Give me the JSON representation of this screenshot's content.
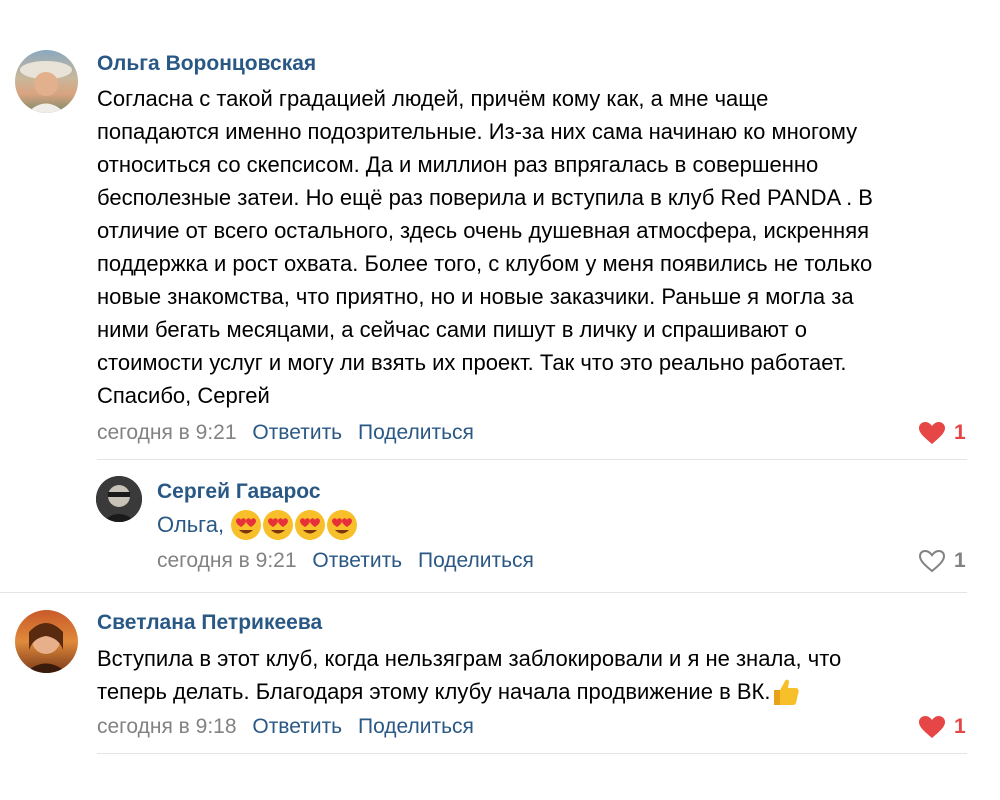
{
  "colors": {
    "author": "#2a5885",
    "meta": "#828282",
    "like_active": "#e64646",
    "divider": "#e3e4e8"
  },
  "comments": [
    {
      "author": "Ольга Воронцовская",
      "lines": [
        "Согласна с такой градацией людей, причём кому как, а мне чаще",
        "попадаются именно подозрительные. Из-за них сама начинаю ко многому",
        "относиться со скепсисом. Да и миллион раз впрягалась в совершенно",
        "бесполезные затеи. Но ещё раз поверила и вступила в клуб Red PANDA . В",
        "отличие от всего остального, здесь очень душевная атмосфера, искренняя",
        "поддержка и рост охвата. Более того, с клубом у меня появились не только",
        "новые знакомства, что приятно, но и новые заказчики. Раньше я могла за",
        "ними бегать месяцами, а сейчас сами пишут в личку и спрашивают о",
        "стоимости услуг и могу ли взять их проект. Так что это реально работает.",
        "Спасибо, Сергей"
      ],
      "time": "сегодня в 9:21",
      "reply": "Ответить",
      "share": "Поделиться",
      "likes": "1",
      "liked": true
    },
    {
      "author": "Сергей Гаварос",
      "text": "Ольга,",
      "emojis": [
        "heart-eyes-emoji",
        "heart-eyes-emoji",
        "heart-eyes-emoji",
        "heart-eyes-emoji"
      ],
      "time": "сегодня в 9:21",
      "reply": "Ответить",
      "share": "Поделиться",
      "likes": "1",
      "liked": false
    },
    {
      "author": "Светлана Петрикеева",
      "lines": [
        "Вступила в этот клуб, когда нельзяграм заблокировали и я не знала, что",
        "теперь делать. Благодаря этому клубу начала продвижение в ВК."
      ],
      "emoji_after": "thumbs-up-emoji",
      "time": "сегодня в 9:18",
      "reply": "Ответить",
      "share": "Поделиться",
      "likes": "1",
      "liked": true
    }
  ]
}
